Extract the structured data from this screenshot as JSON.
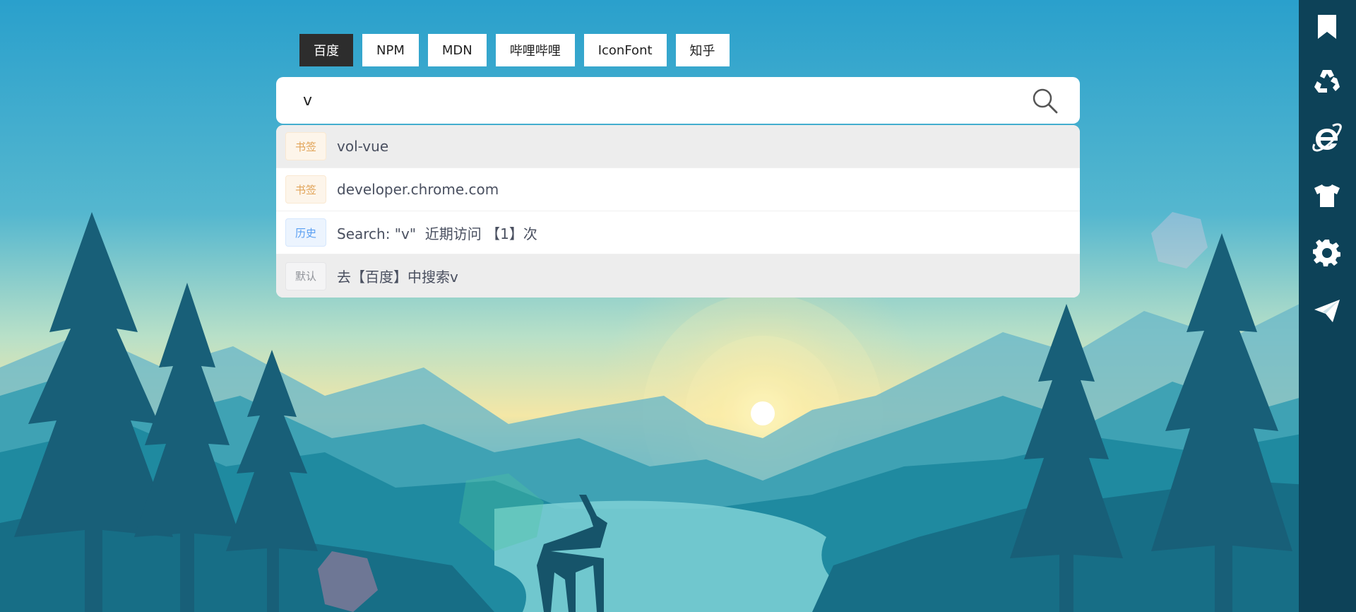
{
  "engines": [
    {
      "label": "百度",
      "active": true
    },
    {
      "label": "NPM",
      "active": false
    },
    {
      "label": "MDN",
      "active": false
    },
    {
      "label": "哔哩哔哩",
      "active": false
    },
    {
      "label": "IconFont",
      "active": false
    },
    {
      "label": "知乎",
      "active": false
    }
  ],
  "search": {
    "value": "v",
    "icon": "search-icon"
  },
  "suggestions": [
    {
      "tag": "书签",
      "text": "vol-vue"
    },
    {
      "tag": "书签",
      "text": "developer.chrome.com"
    },
    {
      "tag": "历史",
      "text": "Search: \"v\"  近期访问 【1】次"
    },
    {
      "tag": "默认",
      "text": "去【百度】中搜索v"
    }
  ],
  "sidebar": {
    "icons": [
      "bookmark-icon",
      "recycle-icon",
      "ie-browser-icon",
      "tshirt-icon",
      "gear-icon",
      "paper-plane-icon"
    ]
  },
  "colors": {
    "active_engine": "#2d2d2d",
    "sidebar": "#0d4258",
    "bookmark_tag": "#e1a357",
    "history_tag": "#5a9ff2",
    "default_tag": "#909399"
  }
}
